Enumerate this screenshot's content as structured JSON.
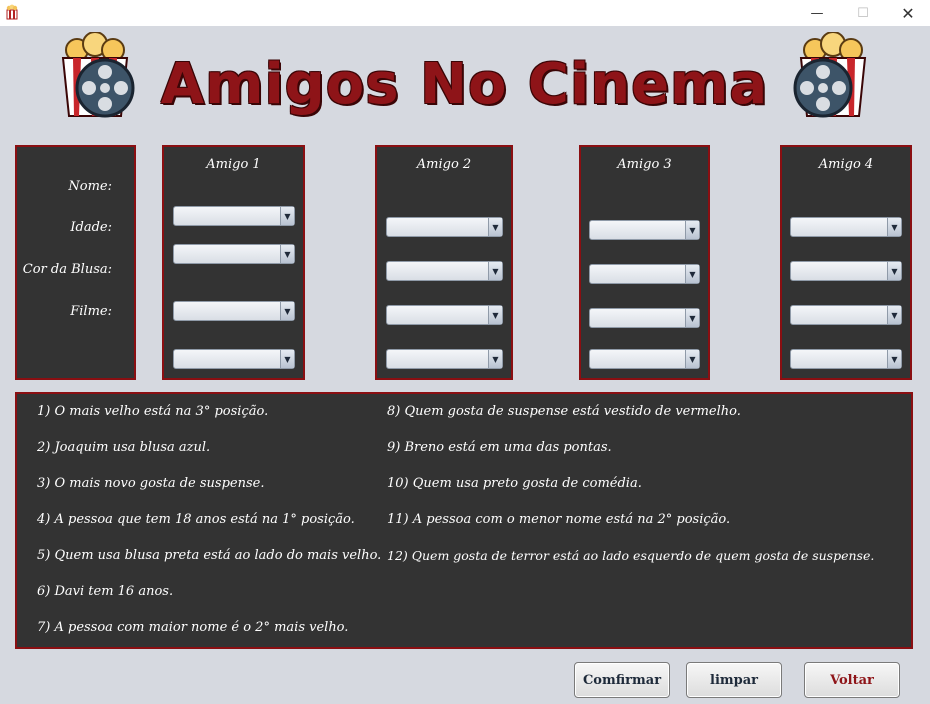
{
  "window": {
    "icon": "popcorn-app-icon",
    "minimize_glyph": "—",
    "maximize_glyph": "☐",
    "close_glyph": "✕"
  },
  "banner": {
    "title": "Amigos No Cinema"
  },
  "field_labels": [
    "Nome:",
    "Idade:",
    "Cor da Blusa:",
    "Filme:"
  ],
  "friends": [
    {
      "title": "Amigo 1"
    },
    {
      "title": "Amigo 2"
    },
    {
      "title": "Amigo 3"
    },
    {
      "title": "Amigo 4"
    }
  ],
  "combo_value": "",
  "hints_left": [
    "1) O mais velho está na 3° posição.",
    "2) Joaquim usa blusa azul.",
    "3) O mais novo gosta de suspense.",
    "4) A pessoa que tem 18 anos está na 1° posição.",
    "5) Quem usa blusa preta está ao lado do mais velho.",
    "6) Davi tem 16 anos.",
    "7) A pessoa com maior nome é o 2° mais velho."
  ],
  "hints_right": [
    "8) Quem gosta de suspense está vestido de vermelho.",
    "9) Breno está em uma das pontas.",
    "10) Quem usa preto gosta de comédia.",
    "11) A pessoa com o menor nome está na 2° posição.",
    "12) Quem gosta de terror está ao lado esquerdo de quem gosta de suspense."
  ],
  "buttons": {
    "confirm": "Comfirmar",
    "clear": "limpar",
    "back": "Voltar"
  },
  "colors": {
    "accent": "#8e1418",
    "panel": "#333333",
    "background": "#d6d9e0"
  }
}
